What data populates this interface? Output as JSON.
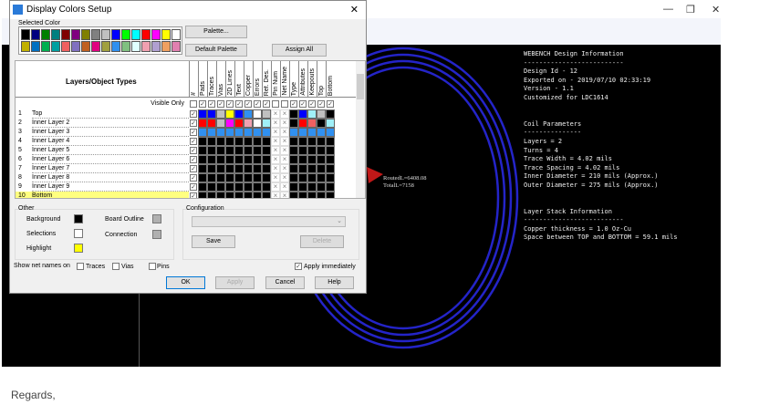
{
  "background_window": {
    "controls": [
      "—",
      "❐",
      "✕"
    ],
    "design_info": [
      "WEBENCH Design Information",
      "--------------------------",
      "Design Id - 12",
      "Exported on - 2019/07/10 02:33:19",
      "Version - 1.1",
      "Customized for LDC1614",
      "",
      "",
      "Coil Parameters",
      "---------------",
      "Layers = 2",
      "Turns = 4",
      "Trace Width = 4.02 mils",
      "Trace Spacing = 4.02 mils",
      "Inner Diameter = 210 mils (Approx.)",
      "Outer Diameter = 275 mils (Approx.)",
      "",
      "",
      "Layer Stack Information",
      "--------------------------",
      "Copper thickness = 1.0 Oz-Cu",
      "Space between TOP and BOTTOM = 59.1 mils"
    ],
    "annotation": [
      "RoutedL=6408.08",
      "TotalL=7158"
    ],
    "coil_color": "#2020c0"
  },
  "page_text": "Regards,",
  "dialog": {
    "title": "Display Colors Setup",
    "close": "✕",
    "selected_color_label": "Selected Color",
    "palette": [
      "#000000",
      "#000080",
      "#008000",
      "#008080",
      "#800000",
      "#800080",
      "#808000",
      "#808080",
      "#c0c0c0",
      "#0000ff",
      "#00ff00",
      "#00ffff",
      "#ff0000",
      "#ff00ff",
      "#ffff00",
      "#ffffff",
      "#c0b000",
      "#0070c0",
      "#00b050",
      "#00a0a0",
      "#f06060",
      "#8070c0",
      "#c06020",
      "#e00080",
      "#a0a040",
      "#3090f0",
      "#80c080",
      "#e0ffff",
      "#f0a0b0",
      "#b0a0d0",
      "#f0a060",
      "#e080b0"
    ],
    "buttons": {
      "palette": "Palette...",
      "default_palette": "Default Palette",
      "assign_all": "Assign All",
      "save": "Save",
      "delete": "Delete",
      "ok": "OK",
      "apply": "Apply",
      "cancel": "Cancel",
      "help": "Help"
    },
    "grid_title": "Layers/Object Types",
    "columns": [
      "#",
      "Pads",
      "Traces",
      "Vias",
      "2D Lines",
      "Text",
      "Copper",
      "Errors",
      "Ref. Des.",
      "Pin Num",
      "Net Name",
      "Type",
      "Attributes",
      "Keepouts",
      "Top",
      "Bottom"
    ],
    "visible_only": "Visible Only",
    "visible_only_checks": [
      false,
      true,
      true,
      true,
      true,
      true,
      true,
      true,
      true,
      false,
      false,
      true,
      true,
      true,
      true,
      true
    ],
    "rows": [
      {
        "n": "1",
        "name": "Top",
        "colors": [
          "#0000ff",
          "#0000ff",
          "#c0c0c0",
          "#ffff00",
          "#0000ff",
          "#3090f0",
          "#ffffff",
          "#c0c0c0",
          "x",
          "x",
          "#000000",
          "#0000ff",
          "#a0f0f8",
          "#c0c0c0",
          "#000000"
        ]
      },
      {
        "n": "2",
        "name": "Inner Layer 2",
        "colors": [
          "#ff0000",
          "#ff0000",
          "#c0c0c0",
          "#ff00ff",
          "#ff0000",
          "#f0a0b0",
          "#ffffff",
          "#a0f0f8",
          "x",
          "x",
          "#000000",
          "#ff0000",
          "#f06060",
          "#000000",
          "#a0f0f8"
        ]
      },
      {
        "n": "3",
        "name": "Inner Layer 3",
        "colors": [
          "#3090f0",
          "#3090f0",
          "#3090f0",
          "#3090f0",
          "#3090f0",
          "#3090f0",
          "#3090f0",
          "#3090f0",
          "x",
          "x",
          "#3090f0",
          "#3090f0",
          "#3090f0",
          "#3090f0",
          "#3090f0"
        ]
      },
      {
        "n": "4",
        "name": "Inner Layer 4",
        "colors": "black"
      },
      {
        "n": "5",
        "name": "Inner Layer 5",
        "colors": "black"
      },
      {
        "n": "6",
        "name": "Inner Layer 6",
        "colors": "black"
      },
      {
        "n": "7",
        "name": "Inner Layer 7",
        "colors": "black"
      },
      {
        "n": "8",
        "name": "Inner Layer 8",
        "colors": "black"
      },
      {
        "n": "9",
        "name": "Inner Layer 9",
        "colors": "black"
      },
      {
        "n": "10",
        "name": "Bottom",
        "colors": "black",
        "highlighted": true
      }
    ],
    "other": {
      "label": "Other",
      "background": "Background",
      "selections": "Selections",
      "highlight": "Highlight",
      "board_outline": "Board Outline",
      "connection": "Connection",
      "colors": {
        "background": "#000000",
        "selections": "#ffffff",
        "highlight": "#ffff00",
        "board_outline": "#b0b0b0",
        "connection": "#b0b0b0"
      }
    },
    "configuration": {
      "label": "Configuration",
      "value": ""
    },
    "show_net_names": {
      "label": "Show net names on",
      "traces": "Traces",
      "vias": "Vias",
      "pins": "Pins"
    },
    "apply_immediately": {
      "label": "Apply immediately",
      "checked": true
    }
  }
}
